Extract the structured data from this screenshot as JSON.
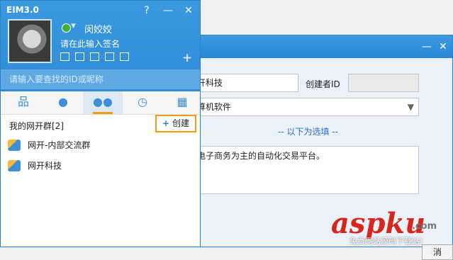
{
  "dialog": {
    "company_value": "开科技",
    "creator_label": "创建者ID",
    "creator_value": "",
    "category_value": "算机软件",
    "optional_sep": "-- 以下为选填 --",
    "desc_value": "电子商务为主的自动化交易平台。",
    "cancel_partial": "消"
  },
  "watermark": {
    "brand": "aspku",
    "suffix": ".com",
    "caption": "免费网站源码下载站!"
  },
  "main": {
    "app_title": "EIM3.0",
    "user_name": "闵姣姣",
    "signature": "请在此输入签名",
    "search_placeholder": "请输入要查找的ID或昵称",
    "group_header": "我的网开群[2]",
    "create_plus": "+",
    "create_label": "创建",
    "groups": [
      {
        "label": "网开-内部交流群"
      },
      {
        "label": "网开科技"
      }
    ],
    "tabs": [
      "org-chart",
      "contacts",
      "groups",
      "recent",
      "apps"
    ],
    "active_tab": "groups",
    "accent": "#2f8bd6",
    "highlight": "#f39c12"
  }
}
